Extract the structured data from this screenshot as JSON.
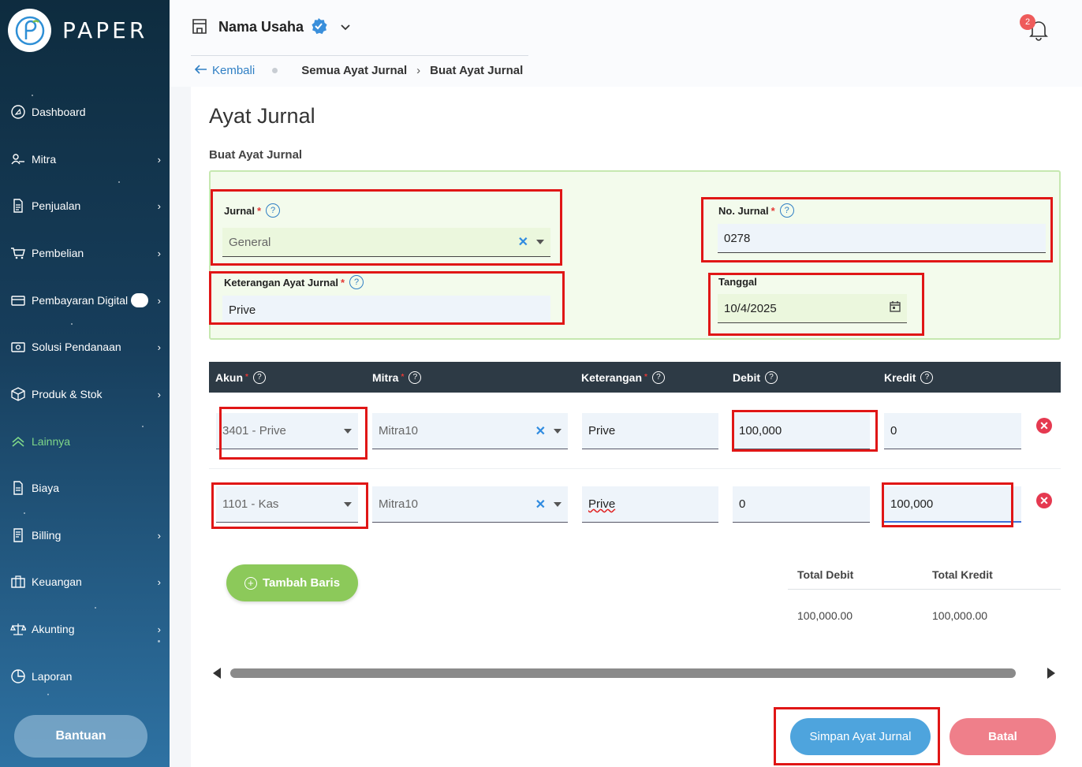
{
  "app": {
    "logo_text": "PAPER"
  },
  "sidebar": {
    "items": [
      {
        "label": "Dashboard",
        "icon": "dashboard-icon",
        "chevron": ""
      },
      {
        "label": "Mitra",
        "icon": "users-icon",
        "chevron": "›"
      },
      {
        "label": "Penjualan",
        "icon": "document-icon",
        "chevron": "›"
      },
      {
        "label": "Pembelian",
        "icon": "cart-icon",
        "chevron": "›"
      },
      {
        "label": "Pembayaran Digital",
        "icon": "card-icon",
        "chevron": "›"
      },
      {
        "label": "Solusi Pendanaan",
        "icon": "money-icon",
        "chevron": "›"
      },
      {
        "label": "Produk & Stok",
        "icon": "box-icon",
        "chevron": "›"
      },
      {
        "label": "Lainnya",
        "icon": "chevron-up-double-icon",
        "chevron": ""
      },
      {
        "label": "Biaya",
        "icon": "receipt-icon",
        "chevron": ""
      },
      {
        "label": "Billing",
        "icon": "billing-icon",
        "chevron": "›"
      },
      {
        "label": "Keuangan",
        "icon": "briefcase-icon",
        "chevron": "›"
      },
      {
        "label": "Akunting",
        "icon": "scale-icon",
        "chevron": "›"
      },
      {
        "label": "Laporan",
        "icon": "pie-icon",
        "chevron": ""
      }
    ],
    "help_label": "Bantuan"
  },
  "topbar": {
    "business_name": "Nama Usaha",
    "notification_count": "2",
    "back_label": "Kembali",
    "breadcrumb": [
      "Semua Ayat Jurnal",
      "Buat Ayat Jurnal"
    ]
  },
  "page": {
    "title": "Ayat Jurnal",
    "section": "Buat Ayat Jurnal"
  },
  "form": {
    "jurnal_label": "Jurnal",
    "jurnal_value": "General",
    "no_jurnal_label": "No. Jurnal",
    "no_jurnal_value": "0278",
    "keterangan_label": "Keterangan Ayat Jurnal",
    "keterangan_value": "Prive",
    "tanggal_label": "Tanggal",
    "tanggal_value": "10/4/2025",
    "required_mark": "*",
    "help_mark": "?"
  },
  "table": {
    "headers": [
      "Akun",
      "Mitra",
      "Keterangan",
      "Debit",
      "Kredit"
    ],
    "rows": [
      {
        "akun": "3401 - Prive",
        "mitra": "Mitra10",
        "keterangan": "Prive",
        "debit": "100,000",
        "kredit": "0"
      },
      {
        "akun": "1101 - Kas",
        "mitra": "Mitra10",
        "keterangan": "Prive",
        "debit": "0",
        "kredit": "100,000"
      }
    ],
    "add_row_label": "Tambah Baris",
    "total_debit_label": "Total Debit",
    "total_kredit_label": "Total Kredit",
    "total_debit": "100,000.00",
    "total_kredit": "100,000.00"
  },
  "actions": {
    "save_label": "Simpan Ayat Jurnal",
    "cancel_label": "Batal"
  },
  "colors": {
    "accent": "#2f7fc4",
    "highlight": "#e01616",
    "active_nav": "#7fd889",
    "save": "#4ea4dd",
    "cancel": "#ef7f8a"
  }
}
